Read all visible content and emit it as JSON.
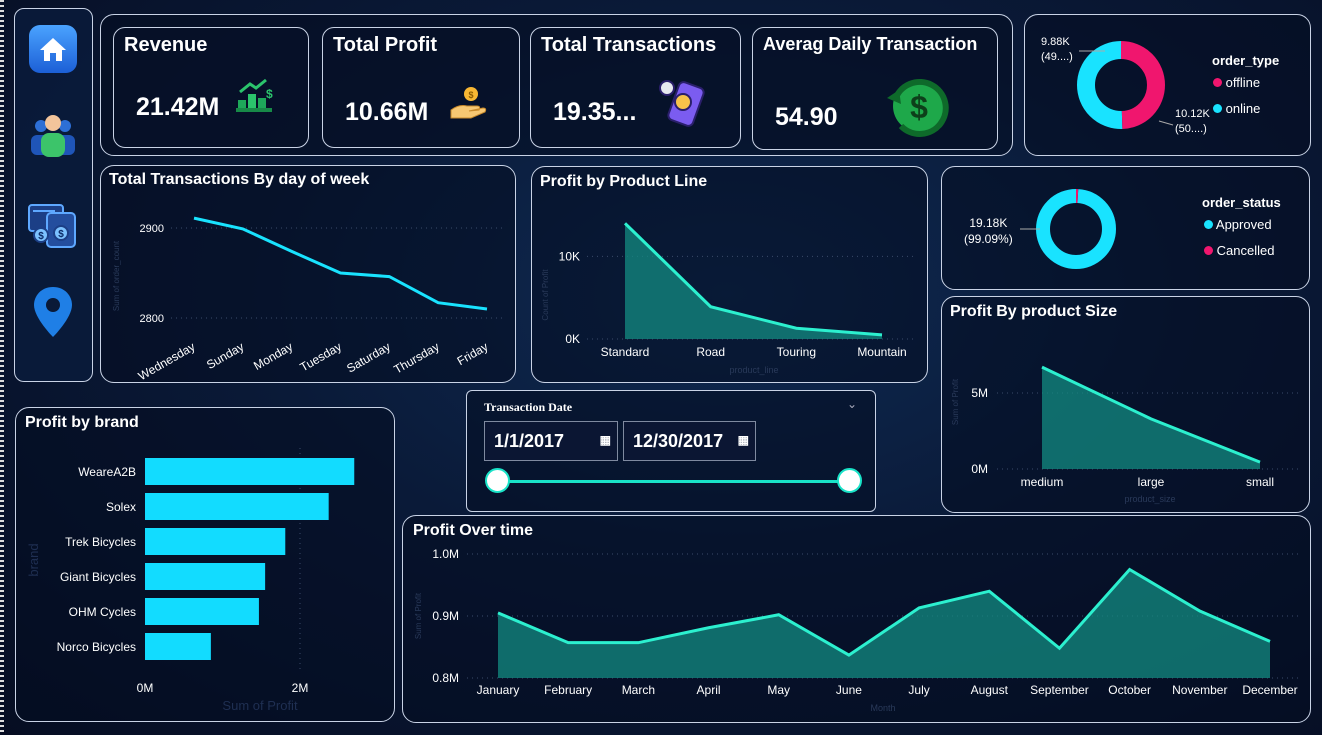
{
  "kpis": {
    "revenue": {
      "title": "Revenue",
      "value": "21.42M"
    },
    "profit": {
      "title": "Total Profit",
      "value": "10.66M"
    },
    "transactions": {
      "title": "Total Transactions",
      "value": "19.35..."
    },
    "avg_daily": {
      "title": "Averag Daily Transaction",
      "value": "54.90"
    }
  },
  "nav": {
    "items": [
      {
        "name": "home-icon"
      },
      {
        "name": "users-icon"
      },
      {
        "name": "transactions-icon"
      },
      {
        "name": "location-pin-icon"
      }
    ]
  },
  "order_type": {
    "title": "order_type",
    "legend": [
      "offline",
      "online"
    ],
    "label_offline_value": "9.88K",
    "label_offline_pct": "(49....)",
    "label_online_value": "10.12K",
    "label_online_pct": "(50....)",
    "colors": {
      "offline": "#f0166e",
      "online": "#19e3ff"
    },
    "values": {
      "offline": 9.88,
      "online": 10.12
    }
  },
  "order_status": {
    "title": "order_status",
    "legend": [
      "Approved",
      "Cancelled"
    ],
    "label_value": "19.18K",
    "label_pct": "(99.09%)",
    "colors": {
      "Approved": "#19e3ff",
      "Cancelled": "#f0166e"
    },
    "values": {
      "Approved": 99.09,
      "Cancelled": 0.91
    }
  },
  "transactions_by_day": {
    "title": "Total Transactions By day of week",
    "ylabel": "Sum of order_count",
    "yticks": [
      "2900",
      "2800"
    ],
    "chart_data": {
      "type": "line",
      "categories": [
        "Wednesday",
        "Sunday",
        "Monday",
        "Tuesday",
        "Saturday",
        "Thursday",
        "Friday"
      ],
      "values": [
        2911,
        2899,
        2874,
        2850,
        2846,
        2817,
        2810
      ],
      "ylim": [
        2780,
        2930
      ]
    }
  },
  "profit_by_product_line": {
    "title": "Profit by Product Line",
    "xlabel": "product_line",
    "ylabel": "Count of Profit",
    "yticks": [
      "10K",
      "0K"
    ],
    "chart_data": {
      "type": "area",
      "categories": [
        "Standard",
        "Road",
        "Touring",
        "Mountain"
      ],
      "values": [
        14000,
        3900,
        1300,
        500
      ],
      "ylim": [
        0,
        15000
      ]
    }
  },
  "profit_by_size": {
    "title": "Profit By product Size",
    "xlabel": "product_size",
    "ylabel": "Sum of Profit",
    "yticks": [
      "5M",
      "0M"
    ],
    "chart_data": {
      "type": "area",
      "categories": [
        "medium",
        "large",
        "small"
      ],
      "values": [
        6700000,
        3300000,
        450000
      ],
      "ylim": [
        0,
        7500000
      ]
    }
  },
  "profit_by_brand": {
    "title": "Profit by brand",
    "xlabel": "Sum of Profit",
    "ylabel": "brand",
    "xticks": [
      "0M",
      "2M"
    ],
    "chart_data": {
      "type": "bar",
      "categories": [
        "WeareA2B",
        "Solex",
        "Trek Bicycles",
        "Giant Bicycles",
        "OHM Cycles",
        "Norco Bicycles"
      ],
      "values": [
        2700000,
        2370000,
        1810000,
        1550000,
        1470000,
        850000
      ],
      "xlim": [
        0,
        3000000
      ]
    }
  },
  "date_filter": {
    "title": "Transaction Date",
    "start": "1/1/2017",
    "end": "12/30/2017"
  },
  "profit_over_time": {
    "title": "Profit Over time",
    "xlabel": "Month",
    "ylabel": "Sum of Profit",
    "yticks": [
      "1.0M",
      "0.9M",
      "0.8M"
    ],
    "chart_data": {
      "type": "area",
      "categories": [
        "January",
        "February",
        "March",
        "April",
        "May",
        "June",
        "July",
        "August",
        "September",
        "October",
        "November",
        "December"
      ],
      "values": [
        905000,
        857000,
        857000,
        881000,
        902000,
        837000,
        913000,
        940000,
        848000,
        975000,
        908000,
        859000
      ],
      "ylim": [
        800000,
        1000000
      ]
    }
  }
}
